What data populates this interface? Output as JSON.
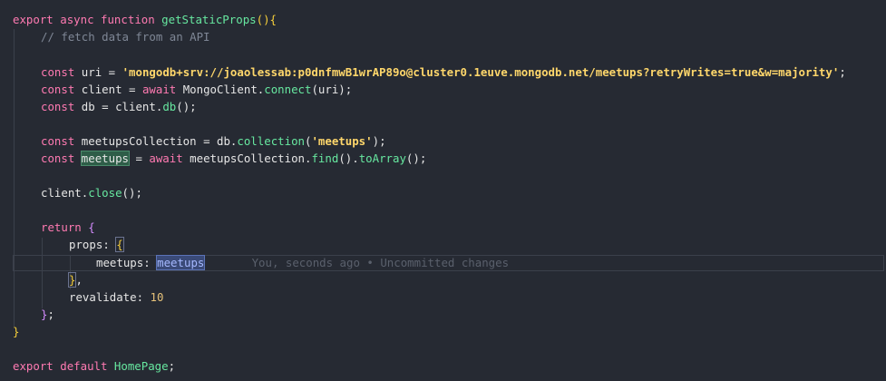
{
  "editor": {
    "lines": {
      "l1": {
        "t1": "export",
        "t2": "async",
        "t3": "function",
        "t4": "getStaticProps",
        "t5": "(){"
      },
      "l2": {
        "comment": "// fetch data from an API"
      },
      "l4": {
        "kw": "const",
        "name": "uri",
        "eq": " = ",
        "str": "'mongodb+srv://joaolessab:p0dnfmwB1wrAP89o@cluster0.1euve.mongodb.net/meetups?retryWrites=true&w=majority'",
        "end": ";"
      },
      "l5": {
        "kw": "const",
        "name": "client",
        "eq": " = ",
        "aw": "await",
        "obj": "MongoClient",
        "dot": ".",
        "m": "connect",
        "arg": "(uri);"
      },
      "l6": {
        "kw": "const",
        "name": "db",
        "eq": " = ",
        "obj": "client",
        "dot": ".",
        "m": "db",
        "end": "();"
      },
      "l8": {
        "kw": "const",
        "name": "meetupsCollection",
        "eq": " = ",
        "obj": "db",
        "dot": ".",
        "m": "collection",
        "open": "(",
        "str": "'meetups'",
        "close": ");"
      },
      "l9": {
        "kw": "const",
        "name": "meetups",
        "eq": " = ",
        "aw": "await",
        "obj": "meetupsCollection",
        "dot": ".",
        "m1": "find",
        "mid": "().",
        "m2": "toArray",
        "end": "();"
      },
      "l11": {
        "obj": "client",
        "dot": ".",
        "m": "close",
        "end": "();"
      },
      "l13": {
        "kw": "return",
        "brace": "{"
      },
      "l14": {
        "prop": "props",
        "colon": ": ",
        "brace": "{"
      },
      "l15": {
        "prop": "meetups",
        "colon": ": ",
        "ref": "meetups",
        "blame": "You, seconds ago • Uncommitted changes"
      },
      "l16": {
        "brace": "}",
        "comma": ","
      },
      "l17": {
        "prop": "revalidate",
        "colon": ": ",
        "num": "10"
      },
      "l18": {
        "brace": "}",
        "end": ";"
      },
      "l19": {
        "brace": "}"
      },
      "l21": {
        "t1": "export",
        "t2": "default",
        "name": "HomePage",
        "end": ";"
      }
    }
  }
}
